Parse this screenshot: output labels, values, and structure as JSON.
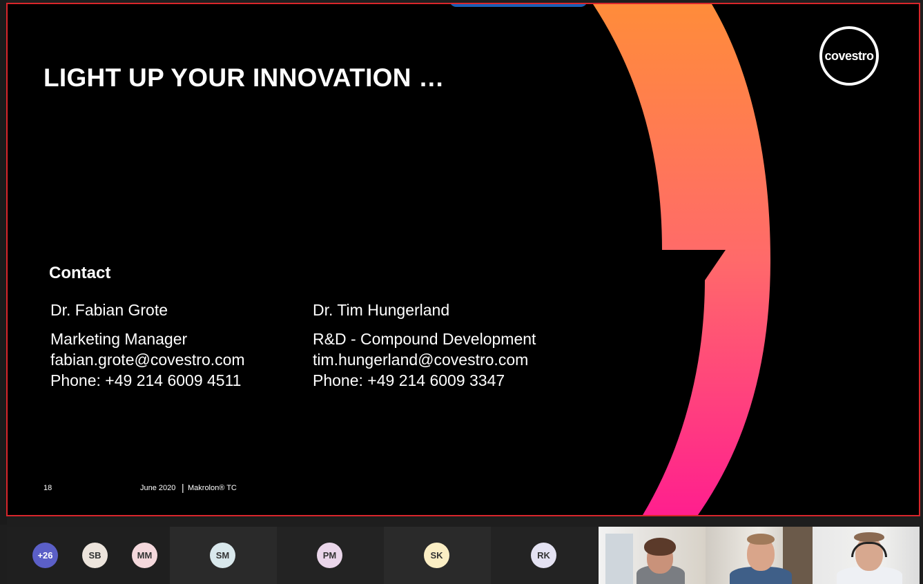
{
  "slide": {
    "title": "LIGHT UP YOUR INNOVATION …",
    "logo_text": "covestro",
    "contact_heading": "Contact",
    "contacts": [
      {
        "name": "Dr. Fabian Grote",
        "role": "Marketing Manager",
        "email": "fabian.grote@covestro.com",
        "phone": "Phone: +49 214 6009 4511"
      },
      {
        "name": "Dr. Tim Hungerland",
        "role": "R&D - Compound Development",
        "email": "tim.hungerland@covestro.com",
        "phone": "Phone: +49 214 6009 3347"
      }
    ],
    "footer": {
      "page_number": "18",
      "date": "June 2020",
      "separator": "|",
      "document": "Makrolon® TC"
    }
  },
  "participants": {
    "overflow_count": "+26",
    "avatars": [
      {
        "initials": "SB",
        "bg": "#ece4dc",
        "fg": "#333333"
      },
      {
        "initials": "MM",
        "bg": "#f4d8dc",
        "fg": "#333333"
      },
      {
        "initials": "SM",
        "bg": "#d9e8ec",
        "fg": "#333333"
      },
      {
        "initials": "PM",
        "bg": "#ead6ea",
        "fg": "#333333"
      },
      {
        "initials": "SK",
        "bg": "#fbeec4",
        "fg": "#333333"
      },
      {
        "initials": "RK",
        "bg": "#e4e2f2",
        "fg": "#333333"
      }
    ],
    "overflow_bg": "#5b5fc7"
  },
  "colors": {
    "share_border": "#d9262b",
    "arc_top": "#ff8c3a",
    "arc_bottom": "#ff1f8e"
  }
}
